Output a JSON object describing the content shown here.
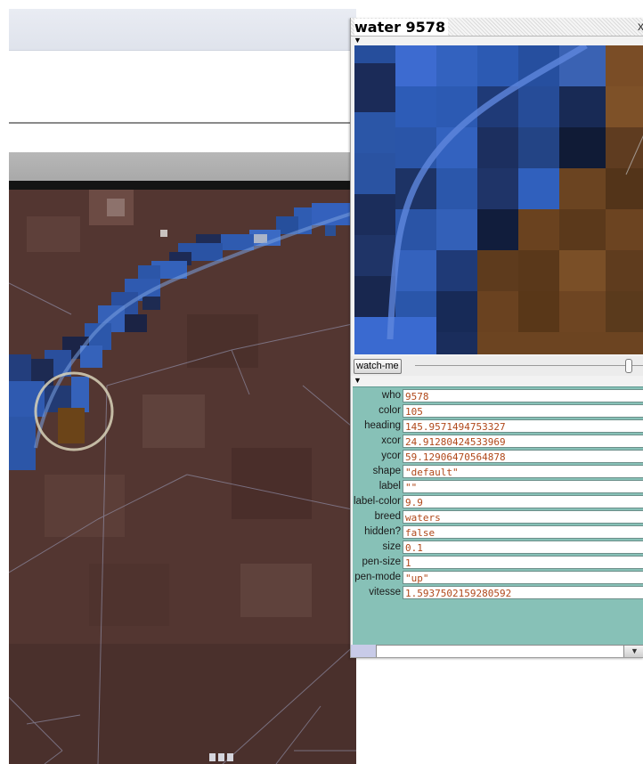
{
  "inspector": {
    "title": "water 9578",
    "close_glyph": "x",
    "collapse_glyph": "▼",
    "watch_button": "watch-me",
    "dropdown_glyph": "▼",
    "command_input": "",
    "variables": [
      {
        "name": "who",
        "value": "9578"
      },
      {
        "name": "color",
        "value": "105"
      },
      {
        "name": "heading",
        "value": "145.9571494753327"
      },
      {
        "name": "xcor",
        "value": "24.91280424533969"
      },
      {
        "name": "ycor",
        "value": "59.12906470564878"
      },
      {
        "name": "shape",
        "value": "\"default\""
      },
      {
        "name": "label",
        "value": "\"\""
      },
      {
        "name": "label-color",
        "value": "9.9"
      },
      {
        "name": "breed",
        "value": "waters"
      },
      {
        "name": "hidden?",
        "value": "false"
      },
      {
        "name": "size",
        "value": "0.1"
      },
      {
        "name": "pen-size",
        "value": "1"
      },
      {
        "name": "pen-mode",
        "value": "\"up\""
      },
      {
        "name": "vitesse",
        "value": "1.5937502159280592"
      }
    ]
  },
  "colors": {
    "terrain_brown": "#5b3a33",
    "water_blue": "#3560b8",
    "variable_panel": "#87c1b7",
    "value_text": "#b0481a",
    "highlight_ring": "#d8d2b8"
  },
  "icons": {
    "close": "close-icon",
    "collapse": "triangle-down-icon",
    "dropdown": "chevron-down-icon"
  }
}
